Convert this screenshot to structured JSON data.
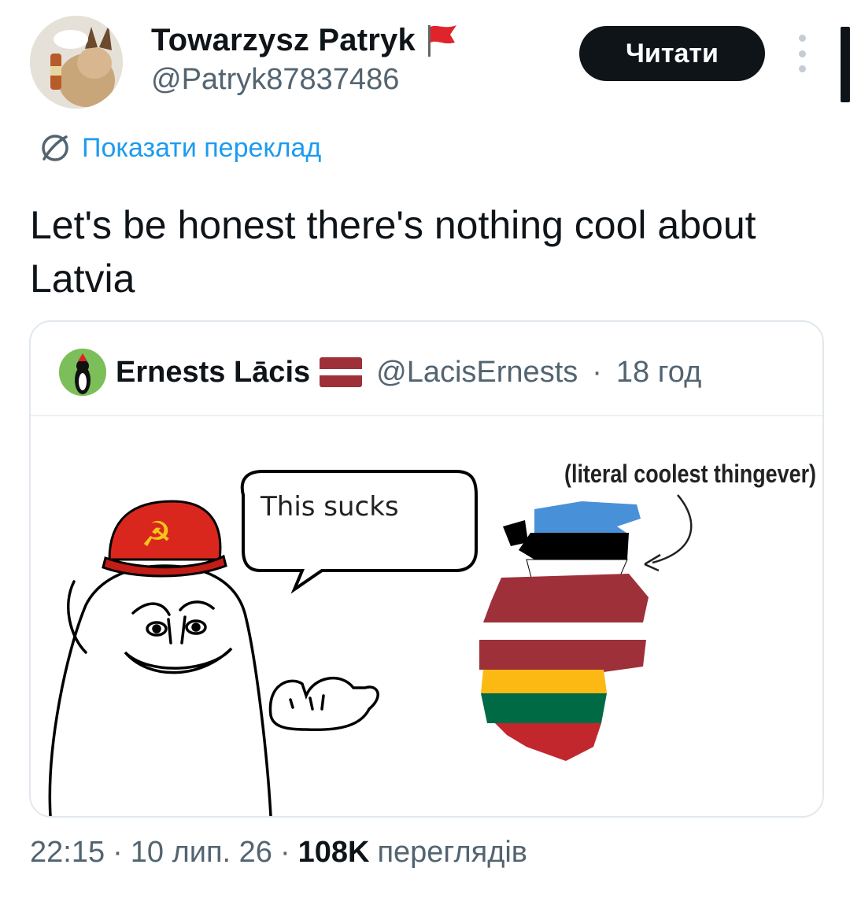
{
  "author": {
    "display_name": "Towarzysz Patryk",
    "handle": "@Patryk87837486",
    "flag_icon": "red-flag-icon"
  },
  "follow_label": "Читати",
  "translate_label": "Показати переклад",
  "tweet_text": "Let's be honest there's nothing cool about Latvia",
  "quote": {
    "display_name": "Ernests Lācis",
    "handle": "@LacisErnests",
    "separator": "·",
    "age": "18 год",
    "meme": {
      "speech_bubble": "This sucks",
      "caption": "(literal coolest thingever)"
    }
  },
  "footer": {
    "time": "22:15",
    "date": "10 лип. 26",
    "views_count": "108K",
    "views_label": "переглядів"
  },
  "colors": {
    "accent": "#1d9bf0",
    "text": "#0f1419",
    "muted": "#536471",
    "estonia": [
      "#4891d9",
      "#000000",
      "#ffffff"
    ],
    "latvia": [
      "#9e3039",
      "#ffffff"
    ],
    "lithuania": [
      "#fdb913",
      "#006a44",
      "#c1272d"
    ]
  }
}
